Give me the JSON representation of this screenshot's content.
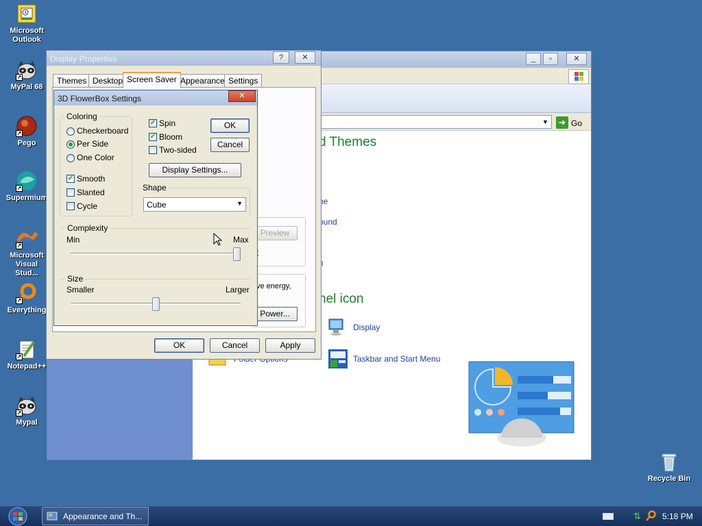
{
  "colors": {
    "desktop": "#3a6ea5",
    "taskbar": "#17345b",
    "theme_green": "#1b7f2b",
    "link_blue": "#1d3f9a"
  },
  "desktop_icons": [
    {
      "label": "Microsoft Outlook",
      "icon": "outlook-icon"
    },
    {
      "label": "MyPal 68",
      "icon": "mypal-icon"
    },
    {
      "label": "Pego",
      "icon": "pego-icon"
    },
    {
      "label": "Supermium",
      "icon": "supermium-icon"
    },
    {
      "label": "Microsoft Visual Stud...",
      "icon": "visual-studio-icon"
    },
    {
      "label": "Everything",
      "icon": "everything-icon"
    },
    {
      "label": "Notepad++",
      "icon": "notepadpp-icon"
    },
    {
      "label": "Mypal",
      "icon": "mypal-icon"
    },
    {
      "label": "Recycle Bin",
      "icon": "recycle-bin-icon"
    }
  ],
  "control_panel": {
    "go_label": "Go",
    "heading1": "d Themes",
    "link1": "ne",
    "link2": "ound",
    "link3": "n",
    "heading2": "nel icon",
    "icon_display": "Display",
    "icon_taskbar": "Taskbar and Start Menu",
    "icon_folder": "Folder Options"
  },
  "display_properties": {
    "title": "Display Properties",
    "help": "?",
    "close": "✕",
    "tabs": [
      "Themes",
      "Desktop",
      "Screen Saver",
      "Appearance",
      "Settings"
    ],
    "active_tab": "Screen Saver",
    "preview_label": "Preview",
    "power_text": "ve energy,",
    "power_button": "Power...",
    "t_fragment": "t",
    "ok": "OK",
    "cancel": "Cancel",
    "apply": "Apply"
  },
  "flowerbox": {
    "title": "3D FlowerBox Settings",
    "coloring_label": "Coloring",
    "coloring_options": [
      "Checkerboard",
      "Per Side",
      "One Color"
    ],
    "coloring_selected": "Per Side",
    "smooth": "Smooth",
    "smooth_checked": true,
    "slanted": "Slanted",
    "slanted_checked": false,
    "cycle": "Cycle",
    "cycle_checked": false,
    "spin": "Spin",
    "spin_checked": true,
    "bloom": "Bloom",
    "bloom_checked": true,
    "two_sided": "Two-sided",
    "two_sided_checked": false,
    "ok": "OK",
    "cancel": "Cancel",
    "display_settings": "Display Settings...",
    "shape_label": "Shape",
    "shape_value": "Cube",
    "complexity_label": "Complexity",
    "complexity_min": "Min",
    "complexity_max": "Max",
    "complexity_level": 1.0,
    "size_label": "Size",
    "size_min": "Smaller",
    "size_max": "Larger",
    "size_level": 0.5
  },
  "taskbar": {
    "task_label": "Appearance and Th...",
    "clock": "5:18 PM"
  }
}
